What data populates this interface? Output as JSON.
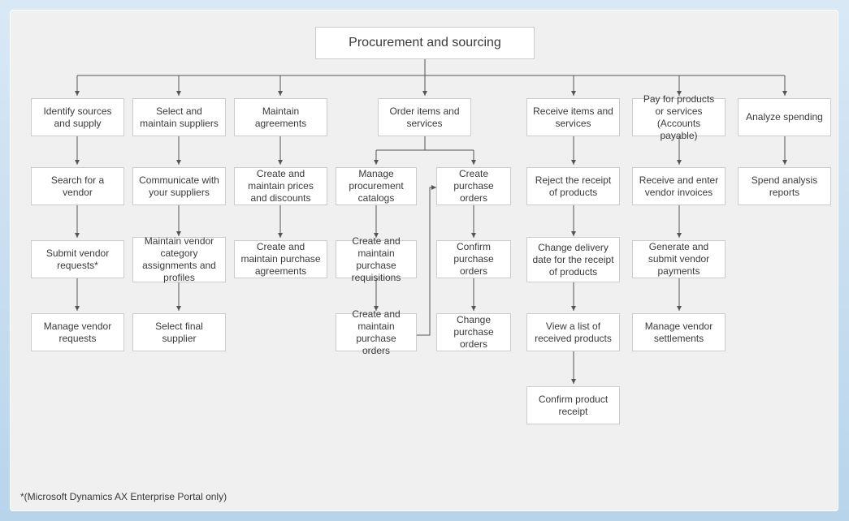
{
  "chart_data": {
    "type": "hierarchy",
    "title": "Procurement and sourcing",
    "footnote": "*(Microsoft Dynamics AX Enterprise Portal only)",
    "root": "Procurement and sourcing",
    "branches": [
      {
        "name": "Identify sources and supply",
        "children": [
          "Search for a vendor",
          "Submit vendor requests*",
          "Manage vendor requests"
        ]
      },
      {
        "name": "Select and maintain suppliers",
        "children": [
          "Communicate with your suppliers",
          "Maintain vendor category assignments and profiles",
          "Select final supplier"
        ]
      },
      {
        "name": "Maintain agreements",
        "children": [
          "Create and maintain prices and discounts",
          "Create and maintain purchase agreements"
        ]
      },
      {
        "name": "Order items and services",
        "sub_branches": [
          {
            "name": "Manage procurement catalogs",
            "children": [
              "Create and maintain purchase requisitions",
              "Create and maintain purchase orders"
            ]
          },
          {
            "name": "Create purchase orders",
            "children": [
              "Confirm purchase orders",
              "Change purchase orders"
            ]
          }
        ],
        "cross_link": {
          "from": "Create and maintain purchase orders",
          "to": "Create purchase orders"
        }
      },
      {
        "name": "Receive items and services",
        "children": [
          "Reject the receipt of products",
          "Change delivery date for the receipt of products",
          "View a list of received products",
          "Confirm product receipt"
        ]
      },
      {
        "name": "Pay for products or services (Accounts payable)",
        "children": [
          "Receive and enter vendor invoices",
          "Generate and submit vendor payments",
          "Manage vendor settlements"
        ]
      },
      {
        "name": "Analyze spending",
        "children": [
          "Spend analysis reports"
        ]
      }
    ]
  },
  "nodes": {
    "root": "Procurement and sourcing",
    "b1": "Identify sources and supply",
    "b1_1": "Search for a vendor",
    "b1_2": "Submit vendor requests*",
    "b1_3": "Manage vendor requests",
    "b2": "Select and maintain suppliers",
    "b2_1": "Communicate with your suppliers",
    "b2_2": "Maintain vendor category assignments and profiles",
    "b2_3": "Select final supplier",
    "b3": "Maintain agreements",
    "b3_1": "Create and maintain prices and discounts",
    "b3_2": "Create and maintain purchase agreements",
    "b4": "Order items and services",
    "b4a": "Manage procurement catalogs",
    "b4a_1": "Create and maintain purchase requisitions",
    "b4a_2": "Create and maintain purchase orders",
    "b4b": "Create purchase orders",
    "b4b_1": "Confirm purchase orders",
    "b4b_2": "Change purchase orders",
    "b5": "Receive items and services",
    "b5_1": "Reject the receipt of products",
    "b5_2": "Change delivery date for the receipt of products",
    "b5_3": "View a list of received products",
    "b5_4": "Confirm product receipt",
    "b6": "Pay for products or services (Accounts payable)",
    "b6_1": "Receive and enter vendor invoices",
    "b6_2": "Generate and submit vendor payments",
    "b6_3": "Manage vendor settlements",
    "b7": "Analyze spending",
    "b7_1": "Spend analysis reports"
  },
  "footnote": "*(Microsoft Dynamics AX Enterprise Portal only)"
}
